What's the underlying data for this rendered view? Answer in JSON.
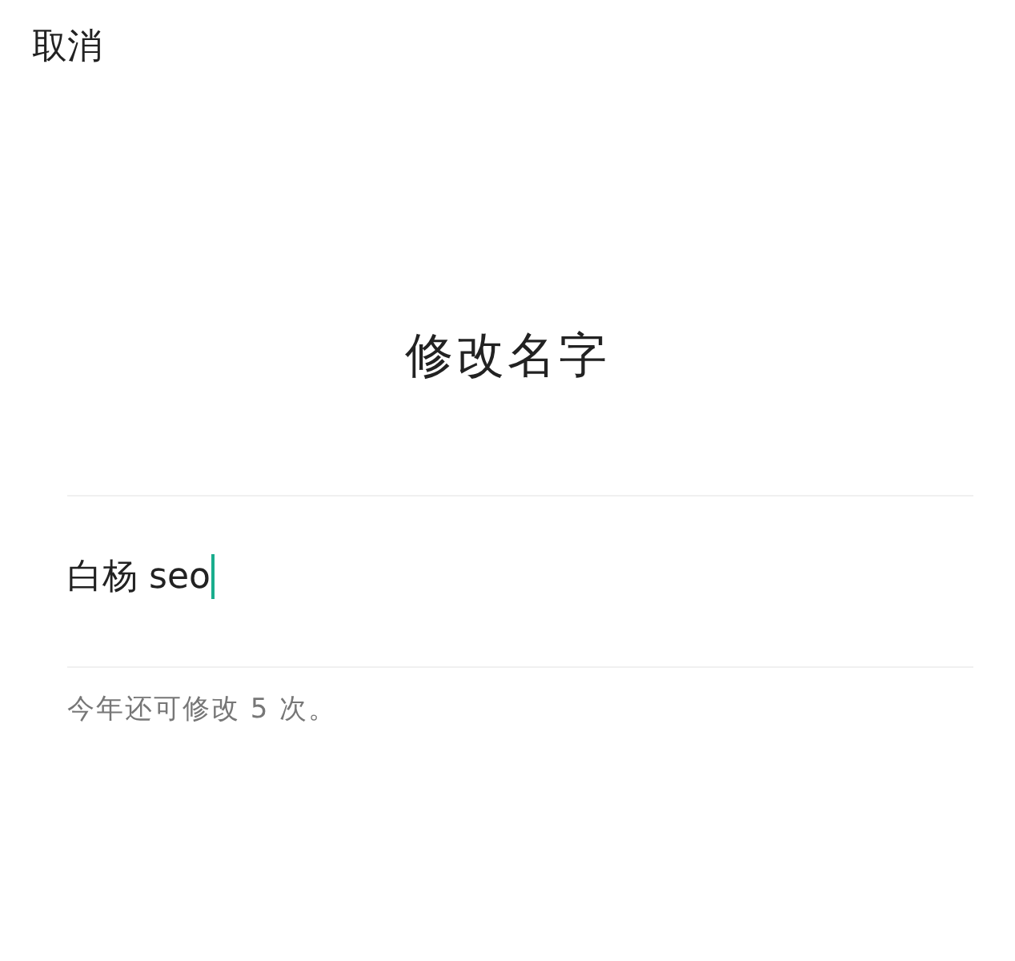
{
  "cancel": {
    "label": "取消"
  },
  "title": "修改名字",
  "name_field": {
    "value": "白杨 seo",
    "focused": true
  },
  "hint": "今年还可修改 5 次。"
}
